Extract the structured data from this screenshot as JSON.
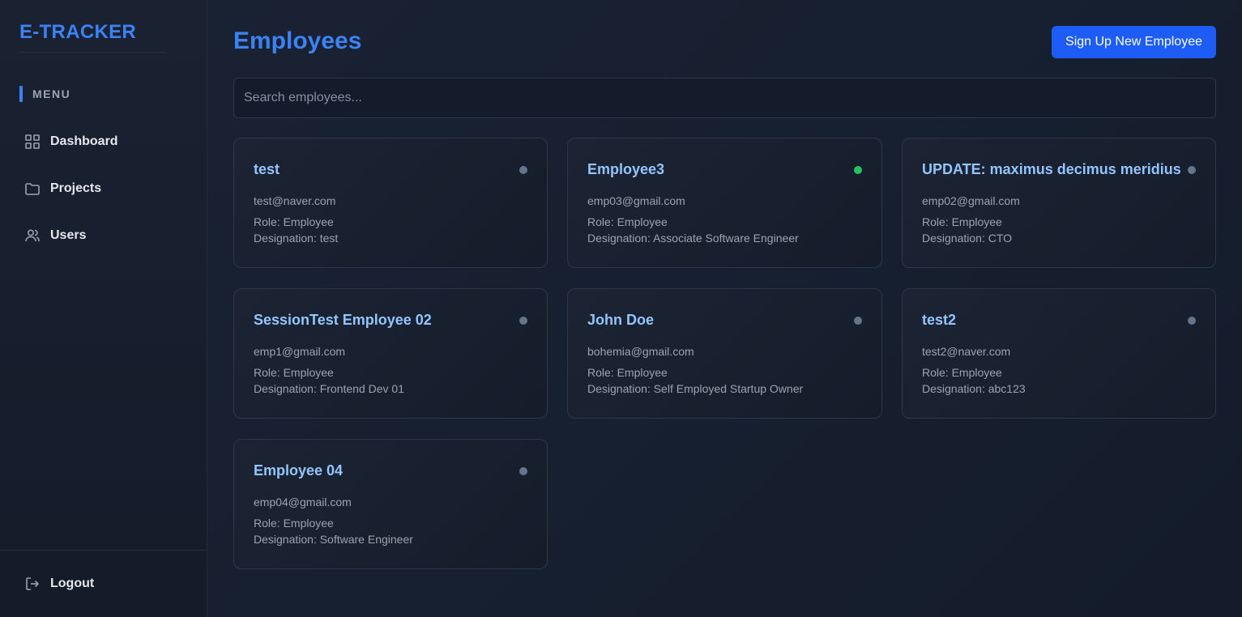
{
  "app": {
    "logo": "E-TRACKER"
  },
  "sidebar": {
    "menu_header": "MENU",
    "items": [
      {
        "label": "Dashboard",
        "icon": "grid-icon"
      },
      {
        "label": "Projects",
        "icon": "folder-icon"
      },
      {
        "label": "Users",
        "icon": "users-icon"
      }
    ],
    "logout": {
      "label": "Logout",
      "icon": "logout-icon"
    }
  },
  "header": {
    "title": "Employees",
    "signup_label": "Sign Up New Employee"
  },
  "search": {
    "placeholder": "Search employees...",
    "value": ""
  },
  "colors": {
    "accent": "#3b82f6",
    "button": "#1d5cf5",
    "status_online": "#22c55e",
    "status_offline": "#64748b"
  },
  "employees": [
    {
      "name": "test",
      "email": "test@naver.com",
      "role": "Role: Employee",
      "designation": "Designation: test",
      "online": false
    },
    {
      "name": "Employee3",
      "email": "emp03@gmail.com",
      "role": "Role: Employee",
      "designation": "Designation: Associate Software Engineer",
      "online": true
    },
    {
      "name": "UPDATE: maximus decimus meridius",
      "email": "emp02@gmail.com",
      "role": "Role: Employee",
      "designation": "Designation: CTO",
      "online": false
    },
    {
      "name": "SessionTest Employee 02",
      "email": "emp1@gmail.com",
      "role": "Role: Employee",
      "designation": "Designation: Frontend Dev 01",
      "online": false
    },
    {
      "name": "John Doe",
      "email": "bohemia@gmail.com",
      "role": "Role: Employee",
      "designation": "Designation: Self Employed Startup Owner",
      "online": false
    },
    {
      "name": "test2",
      "email": "test2@naver.com",
      "role": "Role: Employee",
      "designation": "Designation: abc123",
      "online": false
    },
    {
      "name": "Employee 04",
      "email": "emp04@gmail.com",
      "role": "Role: Employee",
      "designation": "Designation: Software Engineer",
      "online": false
    }
  ]
}
